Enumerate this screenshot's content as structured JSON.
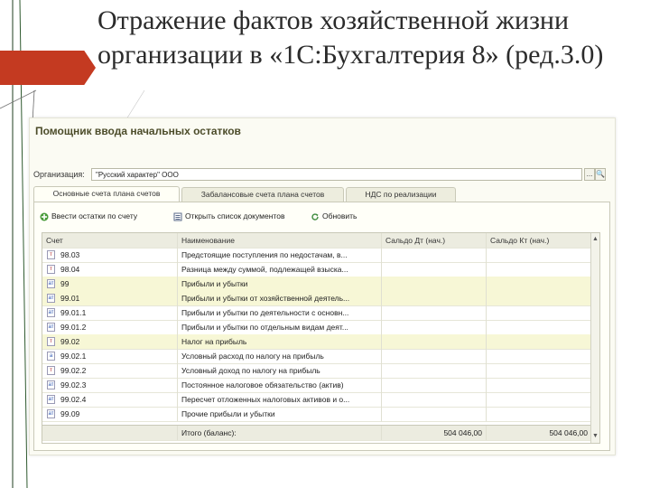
{
  "slide": {
    "title_line1": "Отражение фактов хозяйственной жизни",
    "title_line2": "организации в «1С:Бухгалтерия 8» (ред.3.0)"
  },
  "window": {
    "title": "Помощник ввода начальных остатков",
    "org_label": "Организация:",
    "org_value": "\"Русский характер\" ООО",
    "org_select_btn": "...",
    "org_search_btn": "🔍"
  },
  "tabs": [
    {
      "label": "Основные счета плана счетов",
      "active": true
    },
    {
      "label": "Забалансовые счета плана счетов",
      "active": false
    },
    {
      "label": "НДС по реализации",
      "active": false
    }
  ],
  "toolbar": {
    "enter_balance": "Ввести остатки по счету",
    "open_docs": "Открыть список документов",
    "refresh": "Обновить"
  },
  "table": {
    "columns": [
      "Счет",
      "Наименование",
      "Сальдо Дт (нач.)",
      "Сальдо Кт (нач.)"
    ],
    "rows": [
      {
        "account": "98.03",
        "name": "Предстоящие поступления по недостачам, в...",
        "debit": "",
        "credit": "",
        "highlight": false,
        "icon": "account-icon"
      },
      {
        "account": "98.04",
        "name": "Разница между суммой, подлежащей взыска...",
        "debit": "",
        "credit": "",
        "highlight": false,
        "icon": "account-icon"
      },
      {
        "account": "99",
        "name": "Прибыли и убытки",
        "debit": "",
        "credit": "",
        "highlight": true,
        "icon": "account-icon"
      },
      {
        "account": "99.01",
        "name": "Прибыли и убытки от хозяйственной деятель...",
        "debit": "",
        "credit": "",
        "highlight": true,
        "icon": "account-icon"
      },
      {
        "account": "99.01.1",
        "name": "Прибыли и убытки по деятельности с основн...",
        "debit": "",
        "credit": "",
        "highlight": false,
        "icon": "account-icon"
      },
      {
        "account": "99.01.2",
        "name": "Прибыли и убытки по отдельным видам деят...",
        "debit": "",
        "credit": "",
        "highlight": false,
        "icon": "account-icon"
      },
      {
        "account": "99.02",
        "name": "Налог на прибыль",
        "debit": "",
        "credit": "",
        "highlight": true,
        "icon": "account-icon"
      },
      {
        "account": "99.02.1",
        "name": "Условный расход по налогу на прибыль",
        "debit": "",
        "credit": "",
        "highlight": false,
        "icon": "account-icon"
      },
      {
        "account": "99.02.2",
        "name": "Условный доход по налогу на прибыль",
        "debit": "",
        "credit": "",
        "highlight": false,
        "icon": "account-icon"
      },
      {
        "account": "99.02.3",
        "name": "Постоянное налоговое обязательство (актив)",
        "debit": "",
        "credit": "",
        "highlight": false,
        "icon": "account-icon"
      },
      {
        "account": "99.02.4",
        "name": "Пересчет отложенных налоговых активов и о...",
        "debit": "",
        "credit": "",
        "highlight": false,
        "icon": "account-icon"
      },
      {
        "account": "99.09",
        "name": "Прочие прибыли и убытки",
        "debit": "",
        "credit": "",
        "highlight": false,
        "icon": "account-icon"
      }
    ],
    "total": {
      "label": "Итого (баланс):",
      "debit": "504 046,00",
      "credit": "504 046,00"
    }
  },
  "colors": {
    "accent_red": "#c43a21",
    "row_highlight": "#f7f7d6",
    "title_text": "#4c4c2a"
  }
}
